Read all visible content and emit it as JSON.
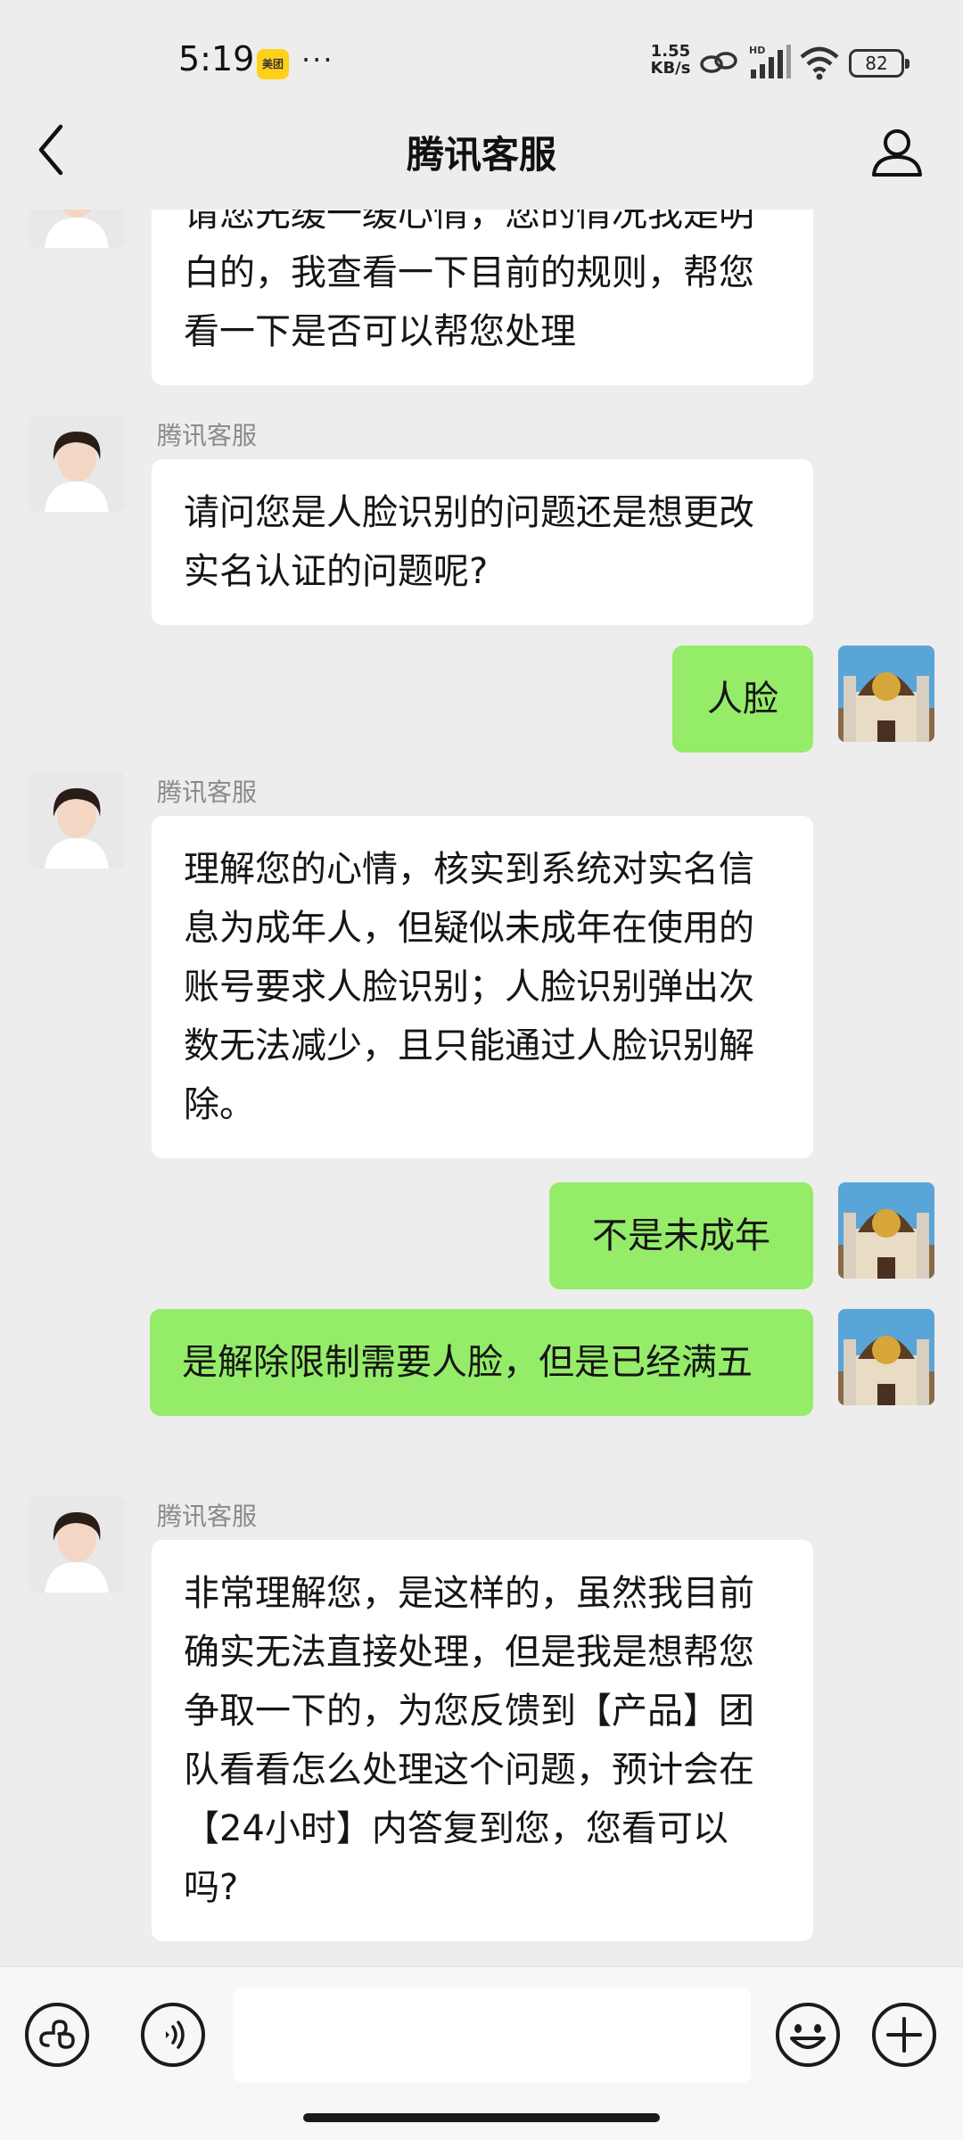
{
  "status_bar": {
    "time": "5:19",
    "app_badge": "美团",
    "more": "···",
    "net_speed_value": "1.55",
    "net_speed_unit": "KB/s",
    "battery": "82"
  },
  "header": {
    "title": "腾讯客服",
    "back_icon": "chevron-left-icon",
    "profile_icon": "person-icon"
  },
  "messages": [
    {
      "from": "agent",
      "sender": "",
      "text": "请您先缓一缓心情，您的情况我是明白的，我查看一下目前的规则，帮您看一下是否可以帮您处理"
    },
    {
      "from": "agent",
      "sender": "腾讯客服",
      "text": "请问您是人脸识别的问题还是想更改实名认证的问题呢?"
    },
    {
      "from": "user",
      "text": "人脸"
    },
    {
      "from": "agent",
      "sender": "腾讯客服",
      "text": "理解您的心情，核实到系统对实名信息为成年人，但疑似未成年在使用的账号要求人脸识别；人脸识别弹出次数无法减少，且只能通过人脸识别解除。"
    },
    {
      "from": "user",
      "text": "不是未成年"
    },
    {
      "from": "user",
      "text": "是解除限制需要人脸，但是已经满五"
    },
    {
      "from": "agent",
      "sender": "腾讯客服",
      "text": "非常理解您，是这样的，虽然我目前确实无法直接处理，但是我是想帮您争取一下的，为您反馈到【产品】团队看看怎么处理这个问题，预计会在【24小时】内答复到您，您看可以吗?"
    }
  ],
  "input_bar": {
    "left_icons": [
      "mini-program-icon",
      "voice-icon"
    ],
    "right_icons": [
      "emoji-icon",
      "plus-icon"
    ],
    "input_value": ""
  },
  "colors": {
    "background": "#ededed",
    "user_bubble": "#95ec69",
    "agent_bubble": "#ffffff"
  }
}
